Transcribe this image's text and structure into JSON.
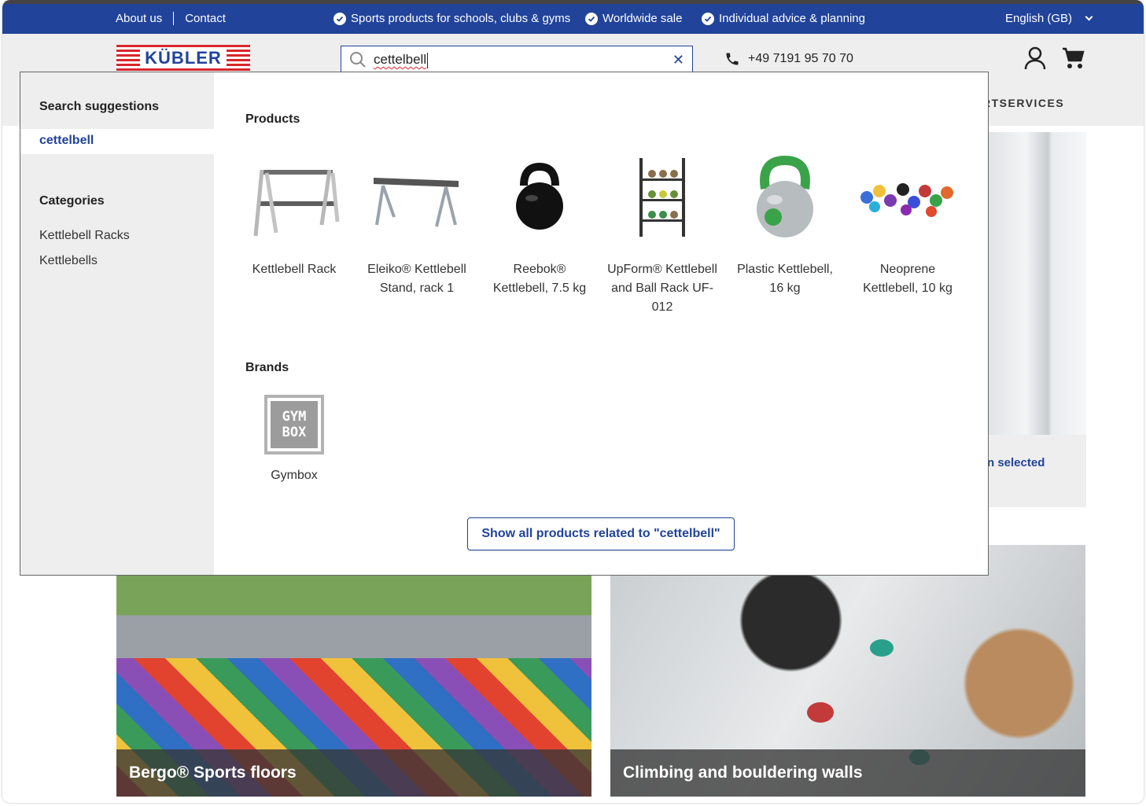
{
  "topbar": {
    "about": "About us",
    "contact": "Contact",
    "usp1": "Sports products for schools, clubs & gyms",
    "usp2": "Worldwide sale",
    "usp3": "Individual advice & planning",
    "language": "English (GB)"
  },
  "header": {
    "logo_text": "KÜBLER",
    "search_value": "cettelbell",
    "phone": "+49 7191 95 70 70",
    "nav_partial": "RTSERVICES",
    "icons": [
      "search-icon",
      "close-icon",
      "phone-icon",
      "account-icon",
      "cart-icon"
    ]
  },
  "background": {
    "selected_partial": "n selected",
    "tile1_caption": "Bergo® Sports floors",
    "tile2_caption": "Climbing and bouldering walls"
  },
  "dropdown": {
    "suggestions_heading": "Search suggestions",
    "suggestion": "cettelbell",
    "categories_heading": "Categories",
    "categories": [
      "Kettlebell Racks",
      "Kettlebells"
    ],
    "products_heading": "Products",
    "products": [
      {
        "name": "Kettlebell Rack"
      },
      {
        "name": "Eleiko® Kettlebell Stand, rack 1"
      },
      {
        "name": "Reebok® Kettlebell, 7.5 kg"
      },
      {
        "name": "UpForm® Kettlebell and Ball Rack UF-012"
      },
      {
        "name": "Plastic Kettlebell, 16 kg"
      },
      {
        "name": "Neoprene Kettlebell, 10 kg"
      }
    ],
    "brands_heading": "Brands",
    "brand": {
      "name": "Gymbox",
      "logo_text": "GYM BOX"
    },
    "show_all": "Show all products related to \"cettelbell\""
  },
  "colors": {
    "brand_blue": "#21439a",
    "logo_red": "#d9262d",
    "panel_grey": "#eeeeee"
  }
}
